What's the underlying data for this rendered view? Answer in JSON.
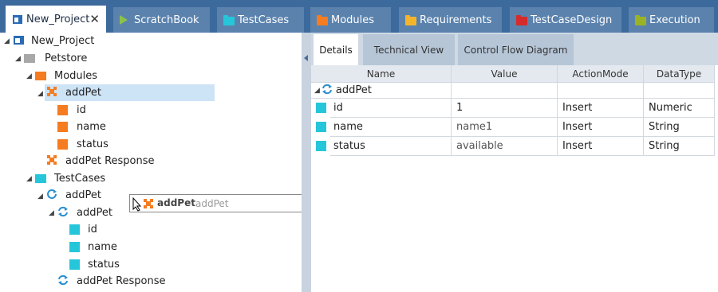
{
  "tabs": [
    {
      "label": "New_Project",
      "icon": "project-icon",
      "active": true
    },
    {
      "label": "ScratchBook",
      "icon": "play-icon",
      "color": "#8bc34a"
    },
    {
      "label": "TestCases",
      "icon": "folder-icon",
      "color": "#26c6da"
    },
    {
      "label": "Modules",
      "icon": "folder-icon",
      "color": "#f57c20"
    },
    {
      "label": "Requirements",
      "icon": "folder-icon",
      "color": "#f5b52b"
    },
    {
      "label": "TestCaseDesign",
      "icon": "folder-icon",
      "color": "#d62b2b"
    },
    {
      "label": "Execution",
      "icon": "folder-icon",
      "color": "#9ab324"
    }
  ],
  "tree": {
    "project": "New_Project",
    "petstore": "Petstore",
    "modules_folder": "Modules",
    "module_addpet": "addPet",
    "attr_id": "id",
    "attr_name": "name",
    "attr_status": "status",
    "module_response": "addPet Response",
    "testcases_folder": "TestCases",
    "tc_addpet": "addPet",
    "tc_step_addpet": "addPet",
    "tc_id": "id",
    "tc_name": "name",
    "tc_status": "status",
    "tc_response": "addPet Response"
  },
  "drag_tooltip": {
    "bold": "addPet",
    "ghost": "addPet"
  },
  "details": {
    "tabs": [
      "Details",
      "Technical View",
      "Control Flow Diagram"
    ],
    "columns": [
      "Name",
      "Value",
      "ActionMode",
      "DataType"
    ],
    "group": "addPet",
    "rows": [
      {
        "name": "id",
        "value": "1",
        "mode": "Insert",
        "type": "Numeric"
      },
      {
        "name": "name",
        "value": "name1",
        "mode": "Insert",
        "type": "String"
      },
      {
        "name": "status",
        "value": "available",
        "mode": "Insert",
        "type": "String"
      }
    ]
  },
  "colors": {
    "accent": "#3d6a9c",
    "module": "#f57c20",
    "testcase": "#26c6da",
    "refresh": "#2a8fd0"
  }
}
